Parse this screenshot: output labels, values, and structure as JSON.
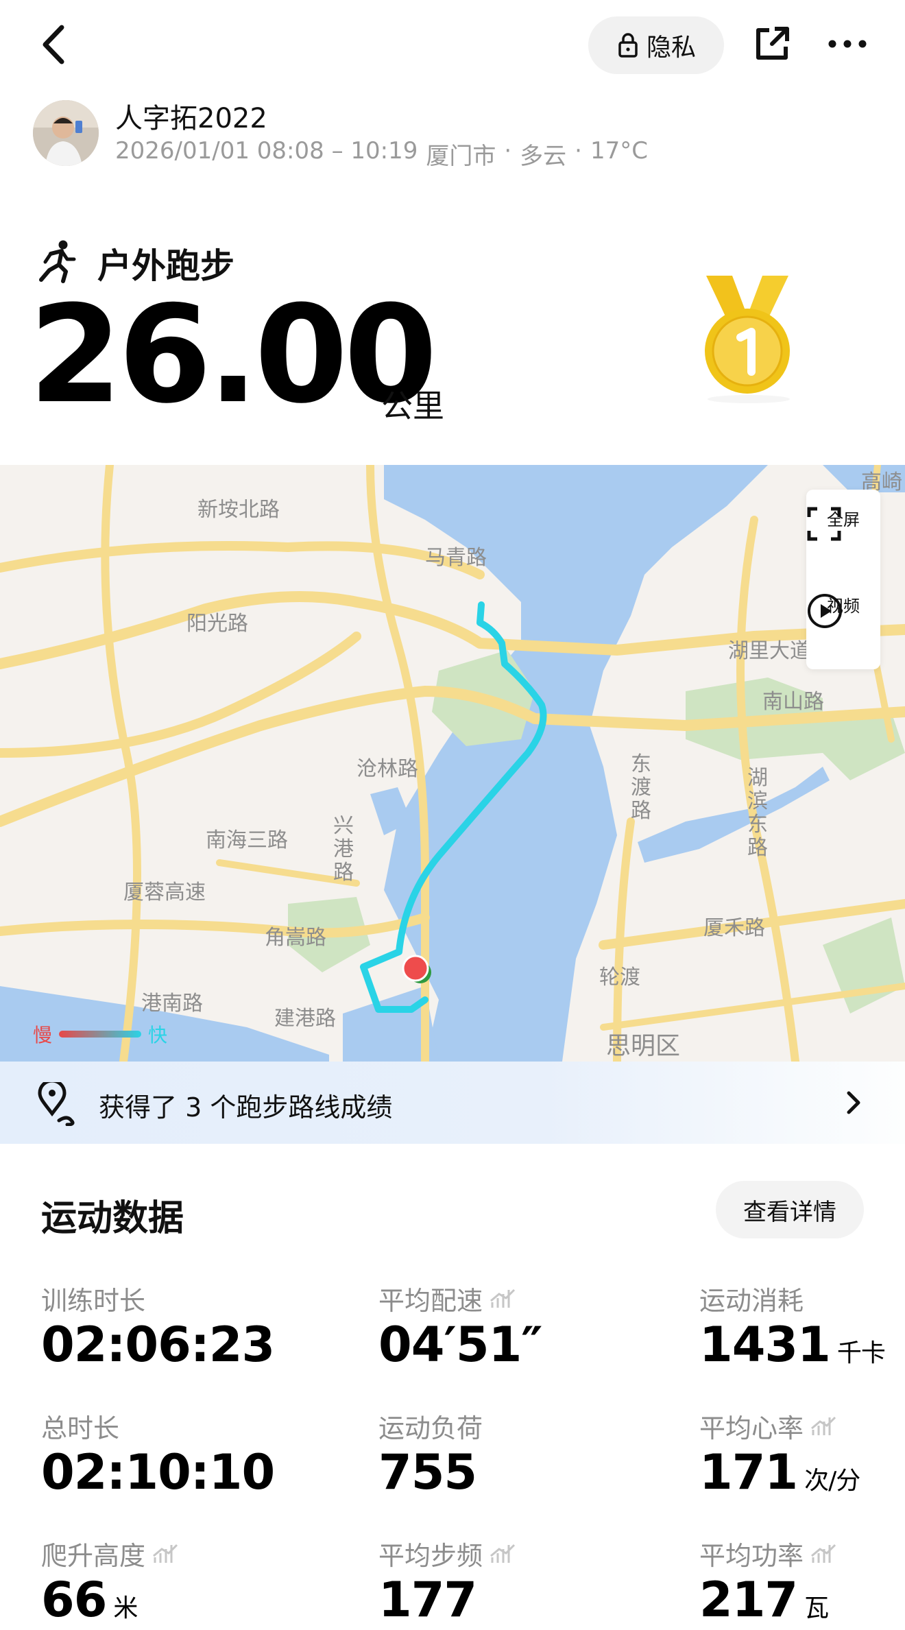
{
  "topbar": {
    "privacy_label": "隐私"
  },
  "user": {
    "name": "人字拓2022",
    "time_range": "2026/01/01 08:08 – 10:19",
    "city": "厦门市",
    "weather": "多云",
    "temperature": "17°C",
    "separator": "·"
  },
  "activity": {
    "type": "户外跑步",
    "distance": "26.00",
    "distance_unit": "公里"
  },
  "map": {
    "labels": [
      "新垵北路",
      "马青路",
      "阳光路",
      "湖里大道",
      "南山路",
      "沧林路",
      "兴港路",
      "南海三路",
      "东渡路",
      "湖滨东路",
      "厦蓉高速",
      "角嵩路",
      "厦禾路",
      "港南路",
      "建港路",
      "轮渡",
      "思明区",
      "高崎"
    ],
    "controls": {
      "fullscreen_label": "全屏",
      "video_label": "视频"
    },
    "legend": {
      "slow": "慢",
      "fast": "快"
    }
  },
  "route_achievement": {
    "text": "获得了 3 个跑步路线成绩"
  },
  "stats": {
    "title": "运动数据",
    "details_button": "查看详情",
    "items": [
      {
        "label": "训练时长",
        "value": "02:06:23",
        "unit": ""
      },
      {
        "label": "平均配速",
        "value": "04′51″",
        "unit": ""
      },
      {
        "label": "运动消耗",
        "value": "1431",
        "unit": "千卡"
      },
      {
        "label": "总时长",
        "value": "02:10:10",
        "unit": ""
      },
      {
        "label": "运动负荷",
        "value": "755",
        "unit": ""
      },
      {
        "label": "平均心率",
        "value": "171",
        "unit": "次/分"
      },
      {
        "label": "爬升高度",
        "value": "66",
        "unit": "米"
      },
      {
        "label": "平均步频",
        "value": "177",
        "unit": ""
      },
      {
        "label": "平均功率",
        "value": "217",
        "unit": "瓦"
      }
    ]
  }
}
